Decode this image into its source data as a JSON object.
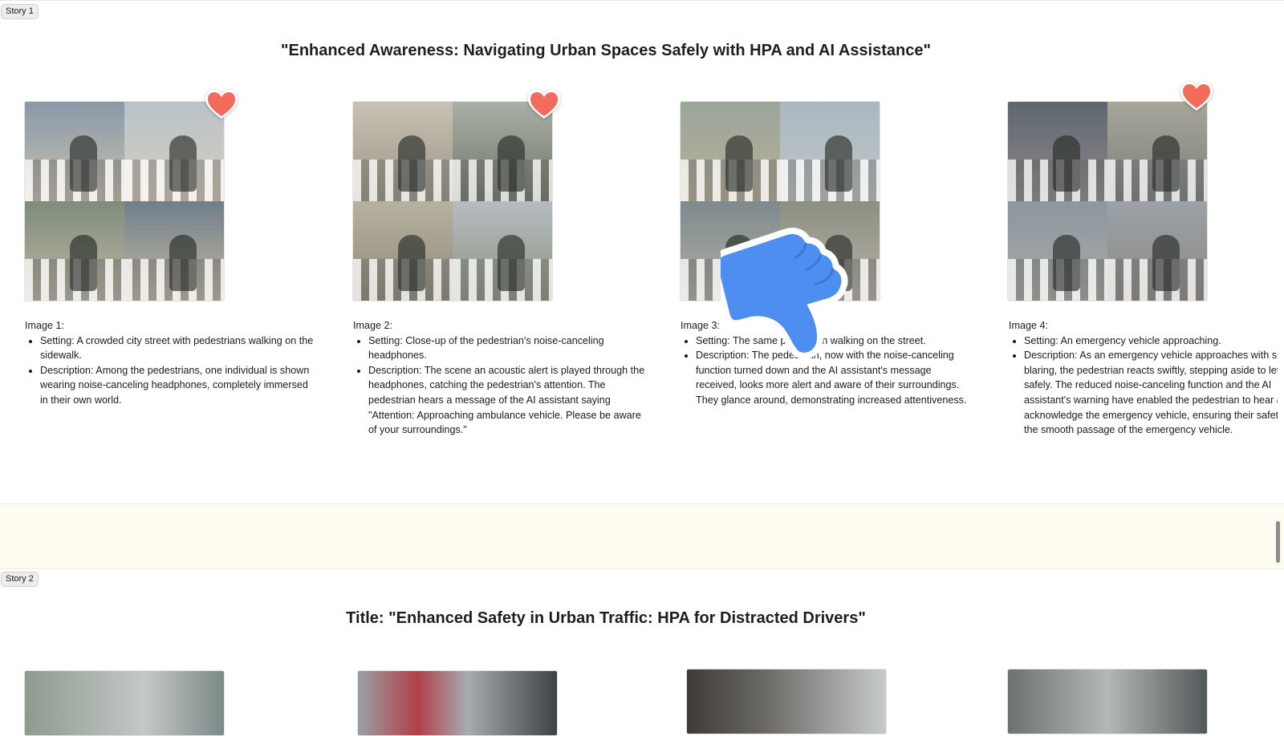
{
  "story1": {
    "tag": "Story 1",
    "title": "\"Enhanced Awareness: Navigating Urban Spaces Safely with HPA and AI Assistance\"",
    "images": [
      {
        "label": "Image 1:",
        "liked": true,
        "bullets": [
          "Setting: A crowded city street with pedestrians walking on the sidewalk.",
          "Description: Among the pedestrians, one individual is shown wearing noise-canceling headphones, completely immersed in their own world."
        ]
      },
      {
        "label": "Image 2:",
        "liked": true,
        "bullets": [
          "Setting: Close-up of the pedestrian's noise-canceling headphones.",
          "Description: The scene an acoustic alert is played through the headphones, catching the pedestrian's attention. The pedestrian hears a message of the AI assistant saying \"Attention: Approaching ambulance vehicle. Please be aware of your surroundings.\""
        ]
      },
      {
        "label": "Image 3:",
        "liked": false,
        "bullets": [
          "Setting: The same pedestrian walking on the street.",
          "Description: The pedestrian, now with the noise-canceling function turned down and the AI assistant's message received, looks more alert and aware of their surroundings. They glance around, demonstrating increased attentiveness."
        ]
      },
      {
        "label": "Image 4:",
        "liked": true,
        "bullets": [
          "Setting: An emergency vehicle approaching.",
          "Description: As an emergency vehicle approaches with siren blaring, the pedestrian reacts swiftly, stepping aside to let it pass safely. The reduced noise-canceling function and the AI assistant's warning have enabled the pedestrian to hear and acknowledge the emergency vehicle, ensuring their safety and the smooth passage of the emergency vehicle."
        ]
      }
    ]
  },
  "story2": {
    "tag": "Story 2",
    "title": "Title: \"Enhanced Safety in Urban Traffic: HPA for Distracted Drivers\""
  },
  "colors": {
    "heart": "#f26b5b",
    "thumbs_down": "#4d8ef0",
    "band": "#fefbf1"
  },
  "icons": {
    "like": "heart-icon",
    "dislike": "thumbs-down-icon"
  }
}
